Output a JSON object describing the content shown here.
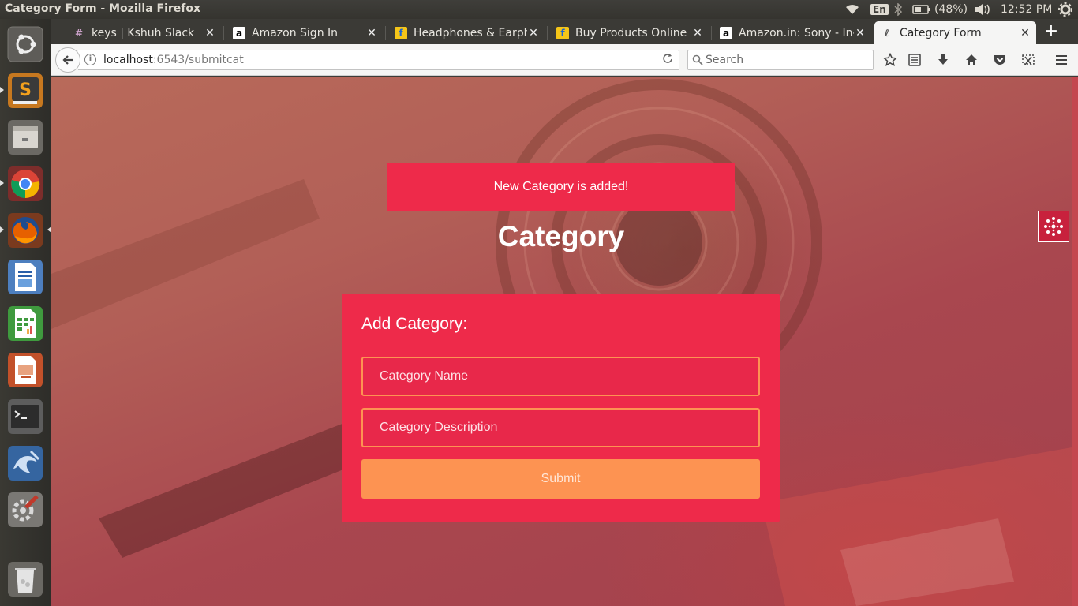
{
  "window": {
    "title": "Category Form - Mozilla Firefox"
  },
  "system_tray": {
    "language": "En",
    "battery": "(48%)",
    "clock": "12:52 PM"
  },
  "launcher": {
    "items": [
      "ubuntu-dash",
      "sublime-text",
      "files",
      "chrome",
      "firefox",
      "libreoffice-writer",
      "libreoffice-calc",
      "libreoffice-impress",
      "terminal",
      "mysql-workbench",
      "system-settings",
      "trash"
    ]
  },
  "tabs": [
    {
      "title": "keys | Kshuh Slack",
      "favicon": "#"
    },
    {
      "title": "Amazon Sign In",
      "favicon": "a"
    },
    {
      "title": "Headphones & Earpho",
      "favicon": "f"
    },
    {
      "title": "Buy Products Online a",
      "favicon": "f"
    },
    {
      "title": "Amazon.in: Sony - In-e",
      "favicon": "a"
    },
    {
      "title": "Category Form",
      "favicon": "ℓ"
    }
  ],
  "nav": {
    "url_host": "localhost",
    "url_rest": ":6543/submitcat",
    "search_placeholder": "Search"
  },
  "page": {
    "flash_message": "New Category is added!",
    "heading": "Category",
    "form": {
      "title": "Add Category:",
      "name_placeholder": "Category Name",
      "name_value": "",
      "description_placeholder": "Category Description",
      "description_value": "",
      "submit_label": "Submit"
    }
  },
  "colors": {
    "accent": "#ee2a4a",
    "button": "#fd9352"
  }
}
